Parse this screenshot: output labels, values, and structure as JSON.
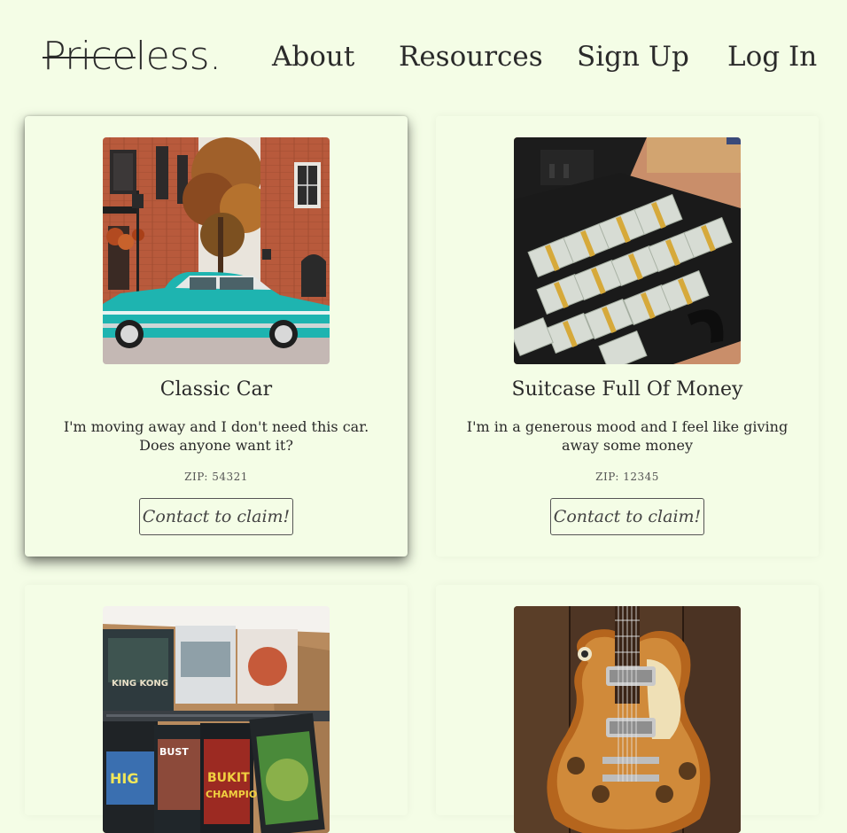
{
  "header": {
    "logo": {
      "struck": "Price",
      "rest": "less."
    },
    "nav": {
      "about": "About",
      "resources": "Resources",
      "signup": "Sign Up",
      "login": "Log In"
    }
  },
  "listings": [
    {
      "title": "Classic Car",
      "description": "I'm moving away and I don't need this car. Does anyone want it?",
      "zip": "ZIP: 54321",
      "button": "Contact to claim!"
    },
    {
      "title": "Suitcase Full Of Money",
      "description": "I'm in a generous mood and I feel like giving away some money",
      "zip": "ZIP: 12345",
      "button": "Contact to claim!"
    },
    {
      "title": "",
      "description": "",
      "zip": "",
      "button": ""
    },
    {
      "title": "",
      "description": "",
      "zip": "",
      "button": ""
    }
  ],
  "colors": {
    "background": "#f4fde6",
    "text": "#2a2a2a"
  }
}
